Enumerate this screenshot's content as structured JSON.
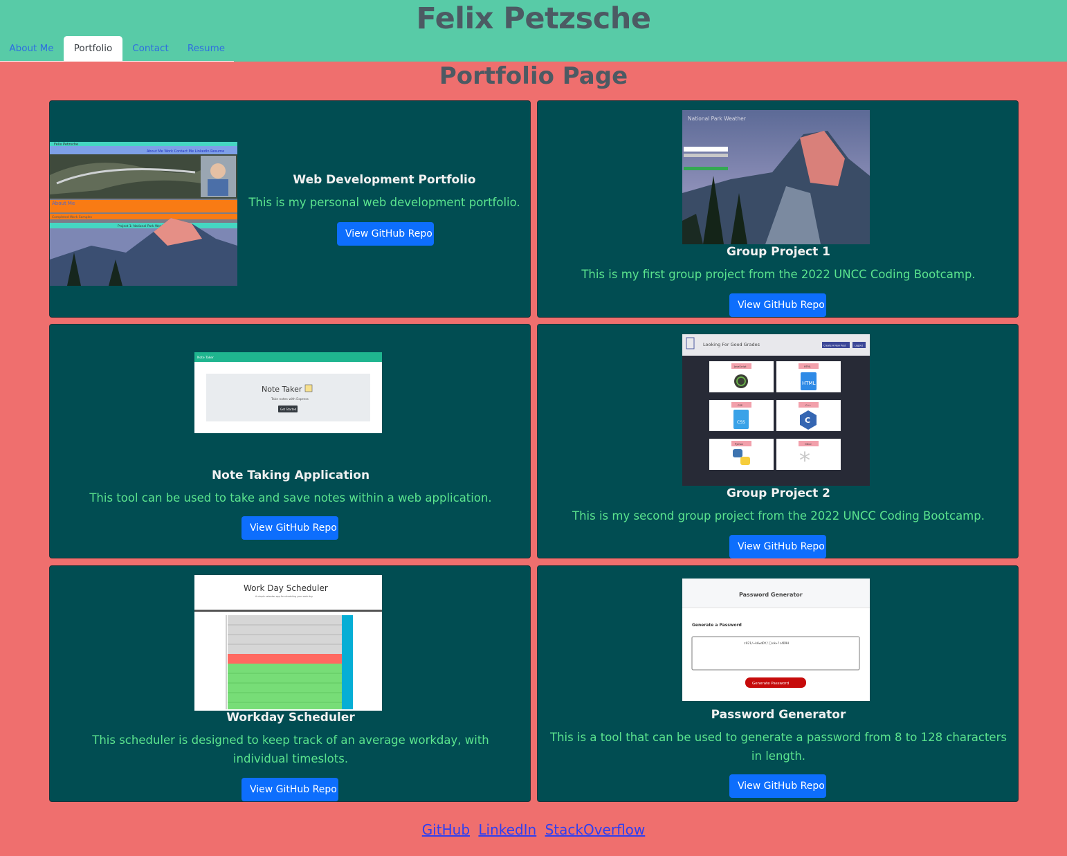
{
  "header": {
    "title": "Felix Petzsche",
    "nav": [
      "About Me",
      "Portfolio",
      "Contact",
      "Resume"
    ],
    "active_tab": "Portfolio"
  },
  "page_title": "Portfolio Page",
  "projects": [
    {
      "title": "Web Development Portfolio",
      "text": "This is my personal web development portfolio.",
      "button": "View GitHub Repo"
    },
    {
      "title": "Group Project 1",
      "text": "This is my first group project from the 2022 UNCC Coding Bootcamp.",
      "button": "View GitHub Repo"
    },
    {
      "title": "Note Taking Application",
      "text": "This tool can be used to take and save notes within a web application.",
      "button": "View GitHub Repo"
    },
    {
      "title": "Group Project 2",
      "text": "This is my second group project from the 2022 UNCC Coding Bootcamp.",
      "button": "View GitHub Repo"
    },
    {
      "title": "Workday Scheduler",
      "text": "This scheduler is designed to keep track of an average workday, with individual timeslots.",
      "button": "View GitHub Repo"
    },
    {
      "title": "Password Generator",
      "text": "This is a tool that can be used to generate a password from 8 to 128 characters in length.",
      "button": "View GitHub Repo"
    }
  ],
  "thumbs": {
    "portfolio": {
      "name": "Felix Petzsche",
      "nav": "About Me  Work  Contact Me  LinkedIn  Resume",
      "about": "About Me",
      "section": "Completed Work Samples",
      "project": "Project 1: National Park Weather"
    },
    "park": {
      "title": "National Park Weather"
    },
    "notes": {
      "bar": "Note Taker",
      "heading": "Note Taker",
      "sub": "Take notes with Express",
      "button": "Get Started"
    },
    "grades": {
      "heading": "Looking For Good Grades",
      "btn1": "Create A New Post",
      "btn2": "Logout",
      "tiles": [
        "JavaScript",
        "HTML",
        "CSS",
        "C++",
        "Python",
        "Other"
      ]
    },
    "scheduler": {
      "heading": "Work Day Scheduler",
      "sub": "A simple calendar app for scheduling your work day"
    },
    "password": {
      "heading": "Password Generator",
      "label": "Generate a Password",
      "value": "zO21/+k6wdDY/[}sk+?c4D9H",
      "button": "Generate Password"
    }
  },
  "footer": {
    "links": [
      "GitHub",
      "LinkedIn",
      "StackOverflow"
    ]
  }
}
